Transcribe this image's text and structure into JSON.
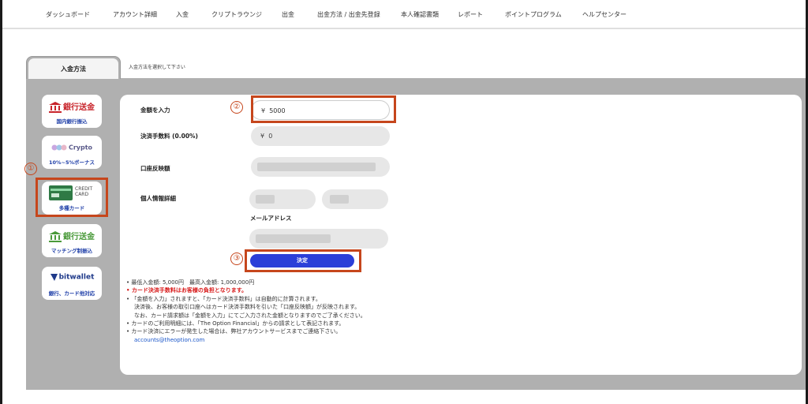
{
  "nav": {
    "items": [
      "ダッシュボード",
      "アカウント詳細",
      "入金",
      "クリプトラウンジ",
      "出金",
      "出金方法 / 出金先登録",
      "本人確認書類",
      "レポート",
      "ポイントプログラム",
      "ヘルプセンター"
    ]
  },
  "tab": {
    "label": "入金方法",
    "hint": "入金方法を選択して下さい"
  },
  "methods": [
    {
      "title": "銀行送金",
      "sub": "国内銀行振込",
      "color": "#c8242b",
      "icon": "bank-icon"
    },
    {
      "title": "Crypto",
      "sub": "10%~5%ボーナス",
      "color": "#6a6a9a",
      "icon": "crypto-icon"
    },
    {
      "title": "CREDIT CARD",
      "sub": "多種カード",
      "color": "#2f7a45",
      "icon": "credit-card-icon"
    },
    {
      "title": "銀行送金",
      "sub": "マッチング制振込",
      "color": "#4a9a3a",
      "icon": "bank-icon"
    },
    {
      "title": "bitwallet",
      "sub": "銀行、カード他対応",
      "color": "#1f3a8a",
      "icon": "bitwallet-icon"
    }
  ],
  "card_tile": {
    "brand": "CREDIT",
    "brand2": "CARD",
    "card_text": "CREDIT CARD"
  },
  "callouts": [
    "①",
    "②",
    "③"
  ],
  "form": {
    "amount_label": "金額を入力",
    "amount_prefix": "¥",
    "amount_value": "5000",
    "fee_label": "決済手数料 (0.00%)",
    "fee_prefix": "¥",
    "fee_value": "0",
    "reflect_label": "口座反映額",
    "personal_label": "個人情報詳細",
    "email_label": "メールアドレス",
    "submit_label": "決定"
  },
  "notes": {
    "line1": "最低入金額: 5,000円　最高入金額: 1,000,000円",
    "line2": "カード決済手数料はお客様の負担となります。",
    "line3": "「金額を入力」されますと、「カード決済手数料」は自動的に計算されます。",
    "line4": "決済後、お客様の取引口座へはカード決済手数料を引いた「口座反映額」が反映されます。",
    "line5": "なお、カード請求額は「金額を入力」にてご入力された金額となりますのでご了承ください。",
    "line6": "カードのご利用明細には、「The Option Financial」からの請求として表記されます。",
    "line7": "カード決済にエラーが発生した場合は、弊社アカウントサービスまでご連絡下さい。",
    "email": "accounts@theoption.com"
  }
}
